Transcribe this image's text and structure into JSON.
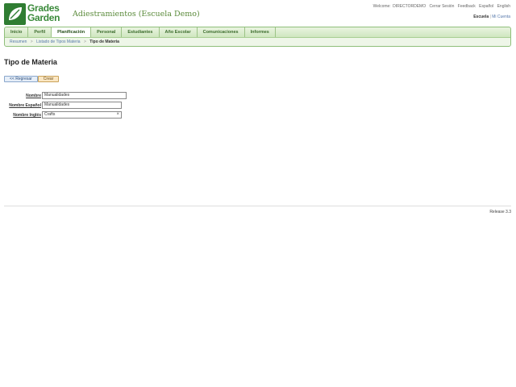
{
  "logo": {
    "line1": "Grades",
    "line2": "Garden"
  },
  "app_title": "Adiestramientos (Escuela Demo)",
  "top_links": {
    "welcome_prefix": "Welcome:",
    "user": "DIRECTORDEMO",
    "logout": "Cerrar Sesión",
    "feedback": "Feedback",
    "spanish": "Español",
    "english": "English"
  },
  "account_links": {
    "school": "Escuela",
    "sep": "|",
    "account": "Mi Cuenta"
  },
  "tabs": [
    {
      "label": "Inicio"
    },
    {
      "label": "Perfil"
    },
    {
      "label": "Planificación"
    },
    {
      "label": "Personal"
    },
    {
      "label": "Estudiantes"
    },
    {
      "label": "Año Escolar"
    },
    {
      "label": "Comunicaciones"
    },
    {
      "label": "Informes"
    }
  ],
  "breadcrumb": {
    "item1": "Resumen",
    "item2": "Listado de Tipos Materia",
    "current": "Tipo de Materia",
    "sep": ">"
  },
  "page_title": "Tipo de Materia",
  "buttons": {
    "back": "<< Regresar",
    "create": "Crear"
  },
  "form": {
    "nombre_label": "Nombre",
    "nombre_value": "Manualidades",
    "nombre_es_label": "Nombre Español",
    "nombre_es_value": "Manualidades",
    "nombre_en_label": "Nombre Inglés",
    "nombre_en_value": "Crafts",
    "clear_glyph": "×"
  },
  "release": "Release 3.3",
  "colors": {
    "accent_green": "#3a8a3a",
    "tab_bg": "#cfe6bf",
    "create_btn": "#fbe7c3"
  }
}
